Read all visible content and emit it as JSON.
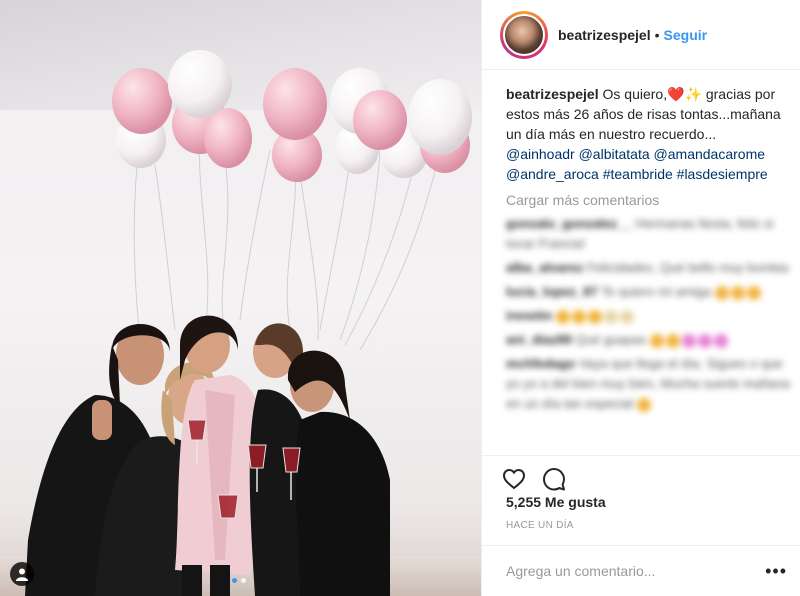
{
  "post": {
    "username": "beatrizespejel",
    "separator": "•",
    "follow_label": "Seguir",
    "caption": {
      "username": "beatrizespejel",
      "text_1": "Os quiero,",
      "heart": "❤️",
      "sparkle": "✨",
      "text_2": " gracias por estos más 26 años de risas tontas...mañana un día más en nuestro recuerdo...",
      "mentions": [
        "@ainhoadr",
        "@albitatata",
        "@amandacarome",
        "@andre_aroca"
      ],
      "hashtags": [
        "#teambride",
        "#lasdesiempre"
      ]
    },
    "load_more_label": "Cargar más comentarios",
    "blurred_comments": [
      {
        "user": "gonzalo_gonzalez__",
        "text": "Hermanas fiesta, feliz si tocar Francia!"
      },
      {
        "user": "alba_alvarez",
        "text": "Felicidades, Qué bello muy bonitas"
      },
      {
        "user": "lucia_lopez_87",
        "text": "Te quiero mi amiga"
      },
      {
        "user": "irenelm",
        "text": ""
      },
      {
        "user": "ani_diaz89",
        "text": "Qué guapas"
      },
      {
        "user": "mchfedago",
        "text": "Vaya que llega el día. Sigues o que yo yo a del bien muy bien, Mucha suerte mañana en un día tan especial"
      }
    ],
    "likes_label": "5,255 Me gusta",
    "time_label": "Hace un día",
    "comment_placeholder": "Agrega un comentario...",
    "more_options_label": "•••"
  },
  "icons": {
    "like": "heart-outline-icon",
    "comment": "speech-bubble-icon",
    "tag": "person-tag-icon",
    "more": "ellipsis-icon"
  },
  "colors": {
    "link": "#003569",
    "follow": "#3897f0",
    "muted": "#999999",
    "border": "#efefef",
    "balloon_pink": "#f2bfcc",
    "balloon_white": "#fbf8f9"
  }
}
